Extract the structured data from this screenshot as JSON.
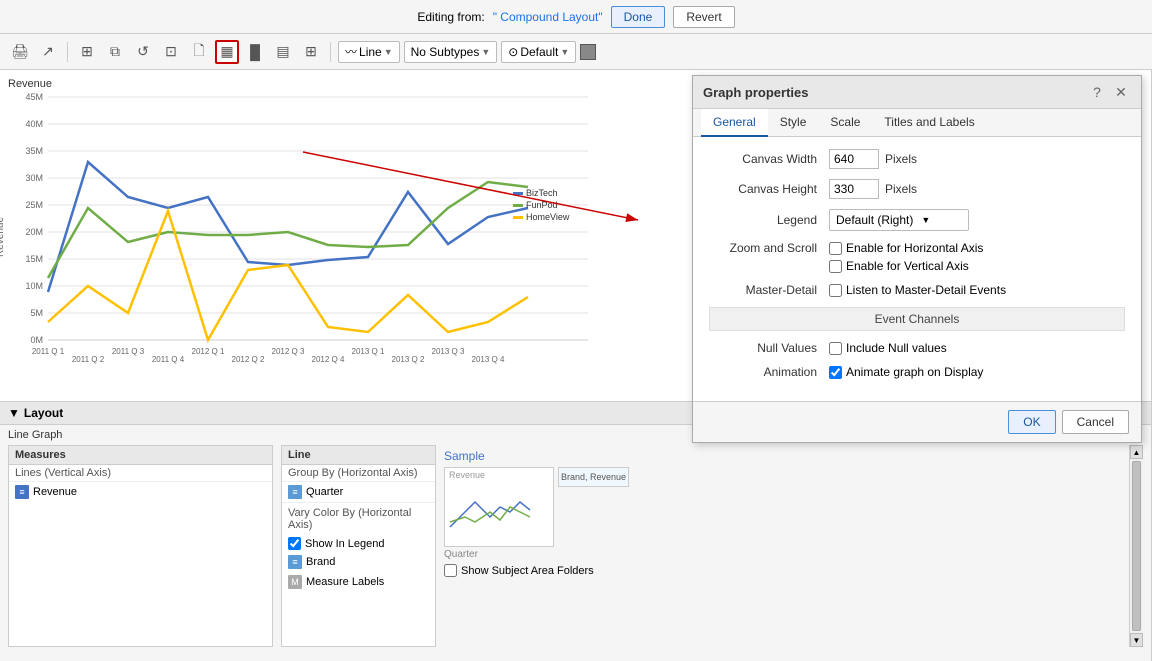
{
  "editing_bar": {
    "text": "Editing from: ",
    "layout_name": "\" Compound Layout\"",
    "done_label": "Done",
    "revert_label": "Revert"
  },
  "toolbar": {
    "buttons": [
      {
        "name": "print-icon",
        "symbol": "🖨"
      },
      {
        "name": "export-icon",
        "symbol": "↗"
      },
      {
        "name": "refresh-icon",
        "symbol": "⟳"
      },
      {
        "name": "edit-icon",
        "symbol": "✎"
      },
      {
        "name": "copy-icon",
        "symbol": "⧉"
      },
      {
        "name": "data-icon",
        "symbol": "⊞"
      },
      {
        "name": "chart-type-selected-icon",
        "symbol": "▦"
      },
      {
        "name": "bar-chart-icon",
        "symbol": "▐"
      },
      {
        "name": "table-icon",
        "symbol": "▤"
      },
      {
        "name": "pivot-icon",
        "symbol": "⊛"
      }
    ],
    "line_dropdown": "Line",
    "subtypes_dropdown": "No Subtypes",
    "default_dropdown": "Default",
    "color_box": "#888"
  },
  "chart": {
    "y_axis_label": "Revenue",
    "y_ticks": [
      "45M",
      "40M",
      "35M",
      "30M",
      "25M",
      "20M",
      "15M",
      "10M",
      "5M",
      "0M"
    ],
    "x_ticks": [
      "2011 Q 1",
      "2011 Q 2",
      "2011 Q 3",
      "2011 Q 4",
      "2012 Q 1",
      "2012 Q 2",
      "2012 Q 3",
      "2012 Q 4",
      "2013 Q 1",
      "2013 Q 2",
      "2013 Q 3",
      "2013 Q 4"
    ],
    "legend": [
      {
        "label": "BizTech",
        "color": "#4472C4"
      },
      {
        "label": "FunPod",
        "color": "#70AD47"
      },
      {
        "label": "HomeView",
        "color": "#FFC000"
      }
    ]
  },
  "layout": {
    "header": "Layout",
    "subheader": "Line Graph",
    "measures": {
      "header": "Measures",
      "subheader": "Lines (Vertical Axis)",
      "item": "Revenue"
    },
    "line": {
      "header": "Line",
      "group_by_label": "Group By (Horizontal Axis)",
      "group_by_item": "Quarter",
      "vary_color_label": "Vary Color By (Horizontal Axis)",
      "show_in_legend_label": "Show In Legend",
      "brand_item": "Brand",
      "measure_labels_item": "Measure Labels"
    },
    "sample": {
      "title": "Sample",
      "revenue_label": "Revenue",
      "brand_revenue_label": "Brand, Revenue",
      "quarter_label": "Quarter"
    },
    "show_subject": "Show Subject Area Folders"
  },
  "graph_properties": {
    "title": "Graph properties",
    "tabs": [
      "General",
      "Style",
      "Scale",
      "Titles and Labels"
    ],
    "active_tab": "General",
    "canvas_width_label": "Canvas Width",
    "canvas_width_value": "640",
    "canvas_height_label": "Canvas Height",
    "canvas_height_value": "330",
    "pixels_label": "Pixels",
    "legend_label": "Legend",
    "legend_value": "Default (Right)",
    "zoom_scroll_label": "Zoom and Scroll",
    "enable_horizontal_label": "Enable for Horizontal Axis",
    "enable_vertical_label": "Enable for Vertical Axis",
    "master_detail_label": "Master-Detail",
    "listen_events_label": "Listen to Master-Detail Events",
    "event_channels_label": "Event Channels",
    "null_values_label": "Null Values",
    "include_null_label": "Include Null values",
    "animation_label": "Animation",
    "animate_label": "Animate graph on Display",
    "ok_label": "OK",
    "cancel_label": "Cancel"
  }
}
